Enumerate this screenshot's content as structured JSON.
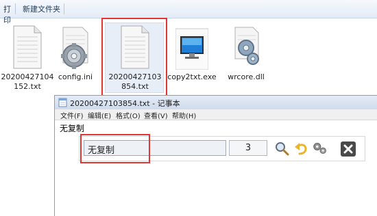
{
  "explorer": {
    "toolbar": {
      "print_label": "打印",
      "new_folder_label": "新建文件夹"
    },
    "files": [
      {
        "name": "20200427104152.txt",
        "icon": "text-file-icon"
      },
      {
        "name": "config.ini",
        "icon": "settings-file-icon"
      },
      {
        "name": "20200427103854.txt",
        "icon": "text-file-icon",
        "selected": true
      },
      {
        "name": "copy2txt.exe",
        "icon": "monitor-app-icon"
      },
      {
        "name": "wrcore.dll",
        "icon": "dll-settings-icon"
      }
    ]
  },
  "notepad": {
    "title": "20200427103854.txt - 记事本",
    "menu": [
      "文件(F)",
      "编辑(E)",
      "格式(O)",
      "查看(V)",
      "帮助(H)"
    ],
    "body_text": "无复制"
  },
  "tool": {
    "input_value": "无复制",
    "count": "3",
    "icons": [
      "search-icon",
      "undo-icon",
      "settings-icon",
      "close-icon"
    ]
  },
  "colors": {
    "highlight": "#e03535",
    "selection": "#e8eef8"
  }
}
